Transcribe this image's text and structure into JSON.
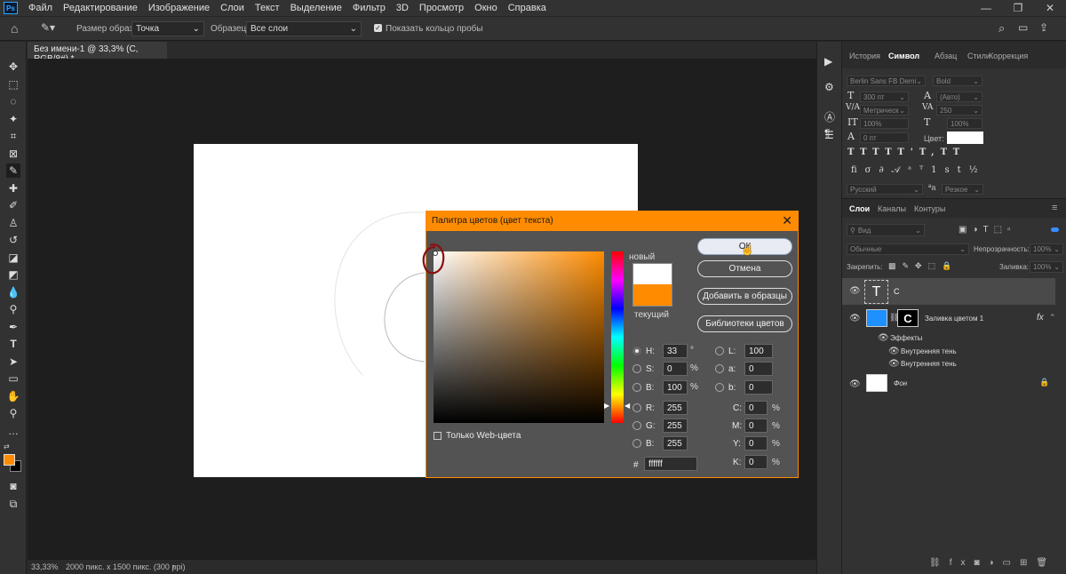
{
  "app": {
    "logo": "Ps"
  },
  "menu": [
    "Файл",
    "Редактирование",
    "Изображение",
    "Слои",
    "Текст",
    "Выделение",
    "Фильтр",
    "3D",
    "Просмотр",
    "Окно",
    "Справка"
  ],
  "options": {
    "sample_size_label": "Размер образца:",
    "sample_size_value": "Точка",
    "sample_label": "Образец:",
    "sample_value": "Все слои",
    "show_ring_label": "Показать кольцо пробы"
  },
  "document": {
    "tab_title": "Без имени-1 @ 33,3% (C, RGB/8#) *"
  },
  "status": {
    "zoom": "33,33%",
    "info": "2000 пикс. x 1500 пикс. (300 ppi)"
  },
  "panel_tabs": [
    "История",
    "Символ",
    "Абзац",
    "Стили",
    "Коррекция"
  ],
  "character": {
    "font": "Berlin Sans FB Demi",
    "style": "Bold",
    "size": "300 пт",
    "leading": "(Авто)",
    "kerning": "Метрическ",
    "tracking": "250",
    "vscale": "100%",
    "hscale": "100%",
    "baseline": "0 пт",
    "color_label": "Цвет:",
    "language": "Русский",
    "aa": "Резкое"
  },
  "layers_tabs": [
    "Слои",
    "Каналы",
    "Контуры"
  ],
  "layers": {
    "search": "Вид",
    "blend": "Обычные",
    "opacity_label": "Непрозрачность:",
    "opacity": "100%",
    "lock_label": "Закрепить:",
    "fill_label": "Заливка:",
    "fill": "100%",
    "items": [
      {
        "name": "C",
        "thumb": "T"
      },
      {
        "name": "Заливка цветом 1",
        "fx": "fx"
      },
      {
        "name": "Эффекты"
      },
      {
        "name": "Внутренняя тень"
      },
      {
        "name": "Внутренняя тень"
      },
      {
        "name": "Фон"
      }
    ]
  },
  "dialog": {
    "title": "Палитра цветов (цвет текста)",
    "new_label": "новый",
    "current_label": "текущий",
    "new_color": "#ffffff",
    "current_color": "#ff8c00",
    "buttons": {
      "ok": "ОК",
      "cancel": "Отмена",
      "add": "Добавить в образцы",
      "libs": "Библиотеки цветов"
    },
    "web_only": "Только Web-цвета",
    "hsb": {
      "H": "33",
      "S": "0",
      "B": "100",
      "H_unit": "°",
      "pct": "%"
    },
    "lab": {
      "L": "100",
      "a": "0",
      "b": "0"
    },
    "rgb": {
      "R": "255",
      "G": "255",
      "B": "255"
    },
    "cmyk": {
      "C": "0",
      "M": "0",
      "Y": "0",
      "K": "0"
    },
    "hex_label": "#",
    "hex": "ffffff",
    "labels": {
      "H": "H:",
      "S": "S:",
      "B": "B:",
      "L": "L:",
      "a": "a:",
      "b": "b:",
      "R": "R:",
      "G": "G:",
      "B2": "B:",
      "C": "C:",
      "M": "M:",
      "Y": "Y:",
      "K": "K:"
    }
  },
  "colors": {
    "accent": "#ff8c00",
    "fill_thumb": "#1e90ff"
  }
}
